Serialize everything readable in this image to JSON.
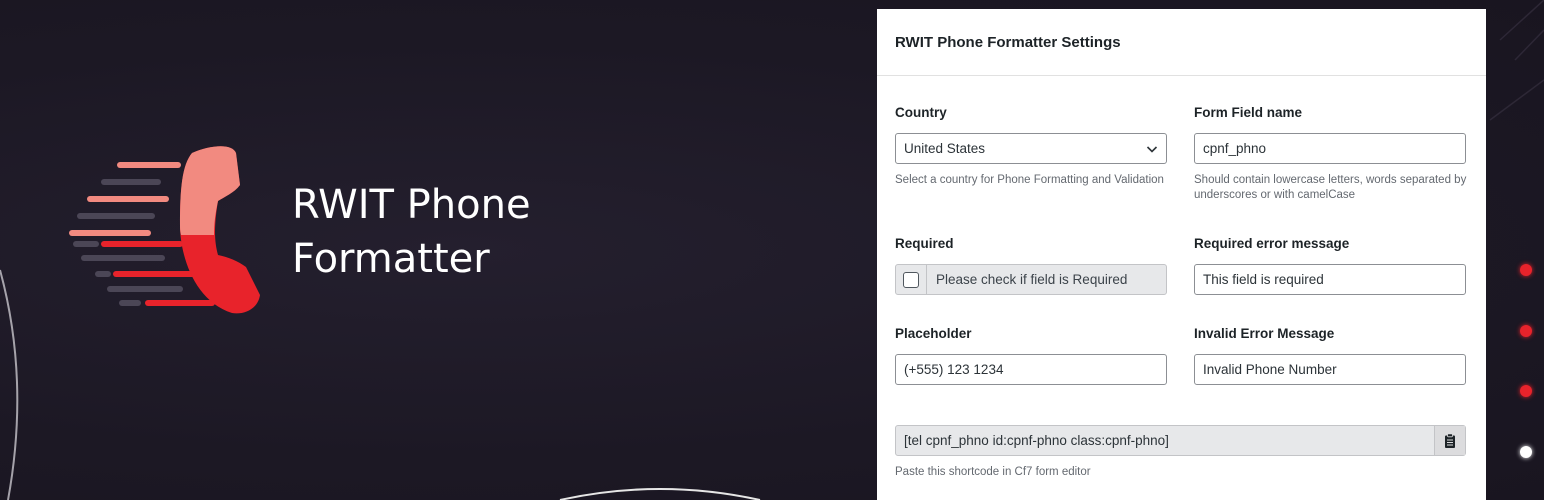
{
  "brand": {
    "title_line1": "RWIT Phone",
    "title_line2": "Formatter"
  },
  "panel": {
    "title": "RWIT Phone Formatter Settings",
    "country": {
      "label": "Country",
      "value": "United States",
      "help": "Select a country for Phone Formatting and Validation"
    },
    "form_field_name": {
      "label": "Form Field name",
      "value": "cpnf_phno",
      "help_line1": "Should contain lowercase letters, words separated by",
      "help_line2": "underscores or with camelCase"
    },
    "required": {
      "label": "Required",
      "checkbox_label": "Please check if field is Required",
      "checked": false
    },
    "required_error": {
      "label": "Required error message",
      "value": "This field is required"
    },
    "placeholder": {
      "label": "Placeholder",
      "value": "(+555) 123 1234"
    },
    "invalid_error": {
      "label": "Invalid Error Message",
      "value": "Invalid Phone Number"
    },
    "shortcode": {
      "value": "[tel cpnf_phno id:cpnf-phno class:cpnf-phno]",
      "help": "Paste this shortcode in Cf7 form editor"
    }
  },
  "icons": {
    "logo": "phone-handset-logo-icon",
    "select": "chevron-down-icon",
    "copy": "clipboard-icon"
  },
  "colors": {
    "background": "#1e1a26",
    "accent_red": "#e8232b",
    "accent_salmon": "#f28a80",
    "panel": "#ffffff"
  }
}
